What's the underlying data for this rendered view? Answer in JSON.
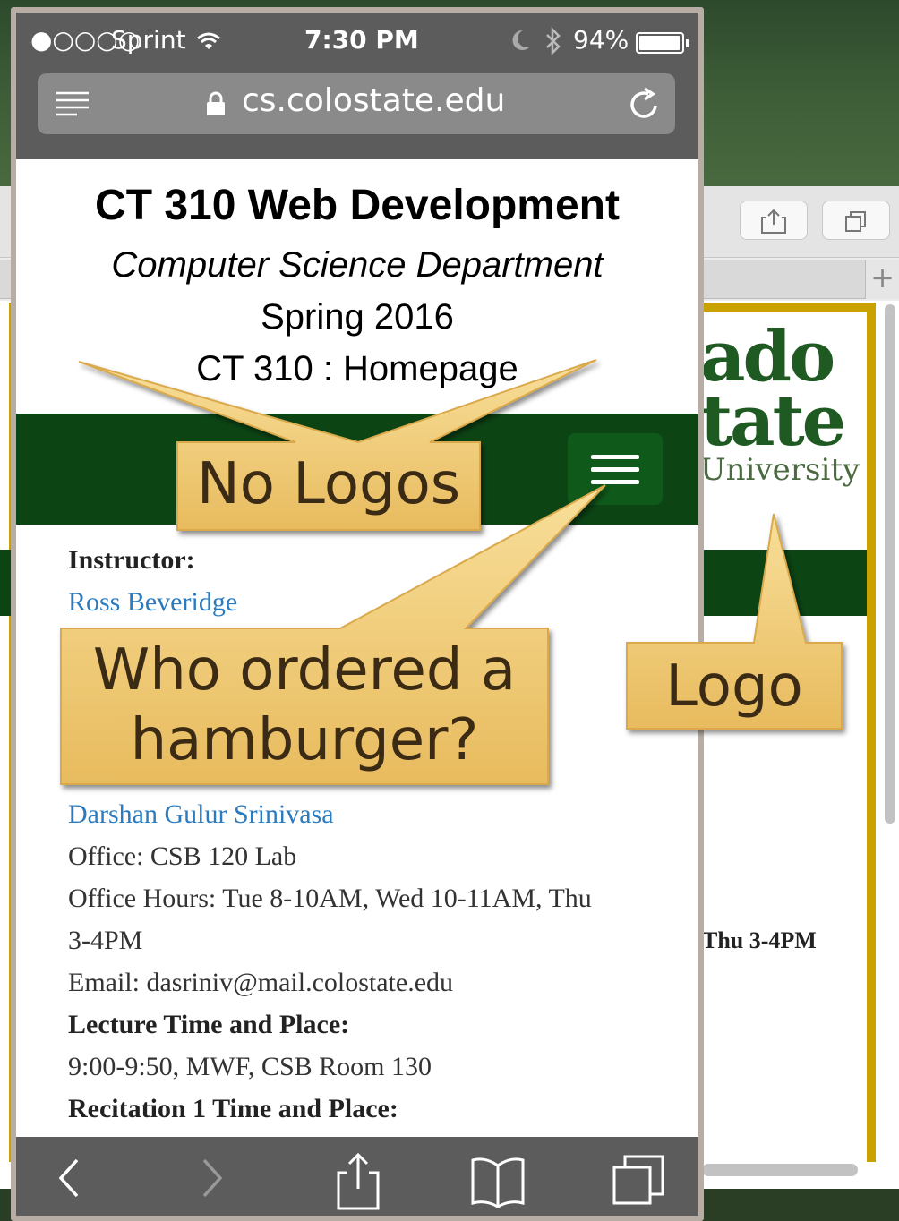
{
  "status_bar": {
    "signal": "●○○○○",
    "carrier": "Sprint",
    "time": "7:30 PM",
    "battery_percent": "94%",
    "battery_level": 0.94
  },
  "url_bar": {
    "url": "cs.colostate.edu"
  },
  "site": {
    "title": "CT 310 Web Development",
    "subtitle": "Computer Science Department",
    "term": "Spring 2016",
    "page": "CT 310 : Homepage"
  },
  "info": {
    "instructor_label": "Instructor:",
    "instructor_name": "Ross Beveridge",
    "ta_name": "Darshan Gulur Srinivasa",
    "ta_office": "Office: CSB 120 Lab",
    "ta_hours_1": "Office Hours: Tue 8-10AM, Wed 10-11AM, Thu",
    "ta_hours_2": "3-4PM",
    "ta_email": "Email: dasriniv@mail.colostate.edu",
    "lecture_label": "Lecture Time and Place:",
    "lecture_value": "9:00-9:50, MWF, CSB Room 130",
    "recitation_label": "Recitation 1 Time and Place:"
  },
  "desktop": {
    "logo_line1": "ado",
    "logo_line2": "tate",
    "logo_line3": "University",
    "hours_fragment": "Thu 3-4PM",
    "tab_plus": "+"
  },
  "callouts": {
    "no_logos": "No Logos",
    "hamburger_line1": "Who ordered a",
    "hamburger_line2": "hamburger?",
    "logo": "Logo"
  }
}
